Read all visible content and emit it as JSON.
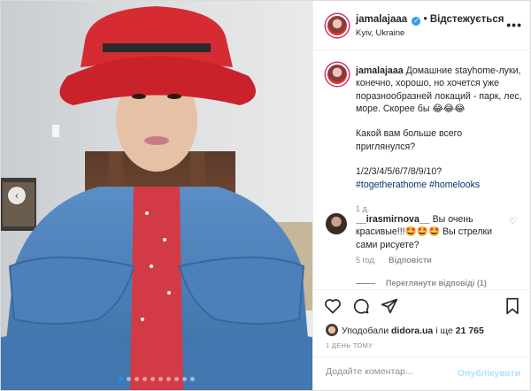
{
  "header": {
    "username": "jamalajaaa",
    "follow_label": "Відстежується",
    "location": "Kyiv, Ukraine",
    "more": "•••"
  },
  "caption": {
    "username": "jamalajaaa",
    "text": "Домашние stayhome-луки, конечно, хорошо, но хочется уже поразнообразней локаций - парк, лес, море. Скорее бы 😂😂😂\n\nКакой вам больше всего приглянулся?\n\n1/2/3/4/5/6/7/8/9/10?",
    "hashtag1": "#togetherathome",
    "hashtag2": "#homelooks",
    "time": "1 д."
  },
  "comment": {
    "username": "__irasmirnova__",
    "text": "Вы очень красивые!!!🤩🤩🤩 Вы стрелки сами рисуете?",
    "time": "5 год.",
    "reply_label": "Відповісти",
    "view_replies": "Переглянути відповіді (1)"
  },
  "likes": {
    "prefix": "Уподобали",
    "user": "didora.ua",
    "mid": "і ще",
    "count": "21 765"
  },
  "date": "1 ДЕНЬ ТОМУ",
  "add_comment": {
    "placeholder": "Додайте коментар...",
    "publish_label": "Опублікувати"
  },
  "carousel": {
    "slide_count": 10,
    "active_index": 0
  },
  "colors": {
    "accent": "#3897f0",
    "hat": "#d62b33",
    "jacket": "#4a7fb8"
  }
}
